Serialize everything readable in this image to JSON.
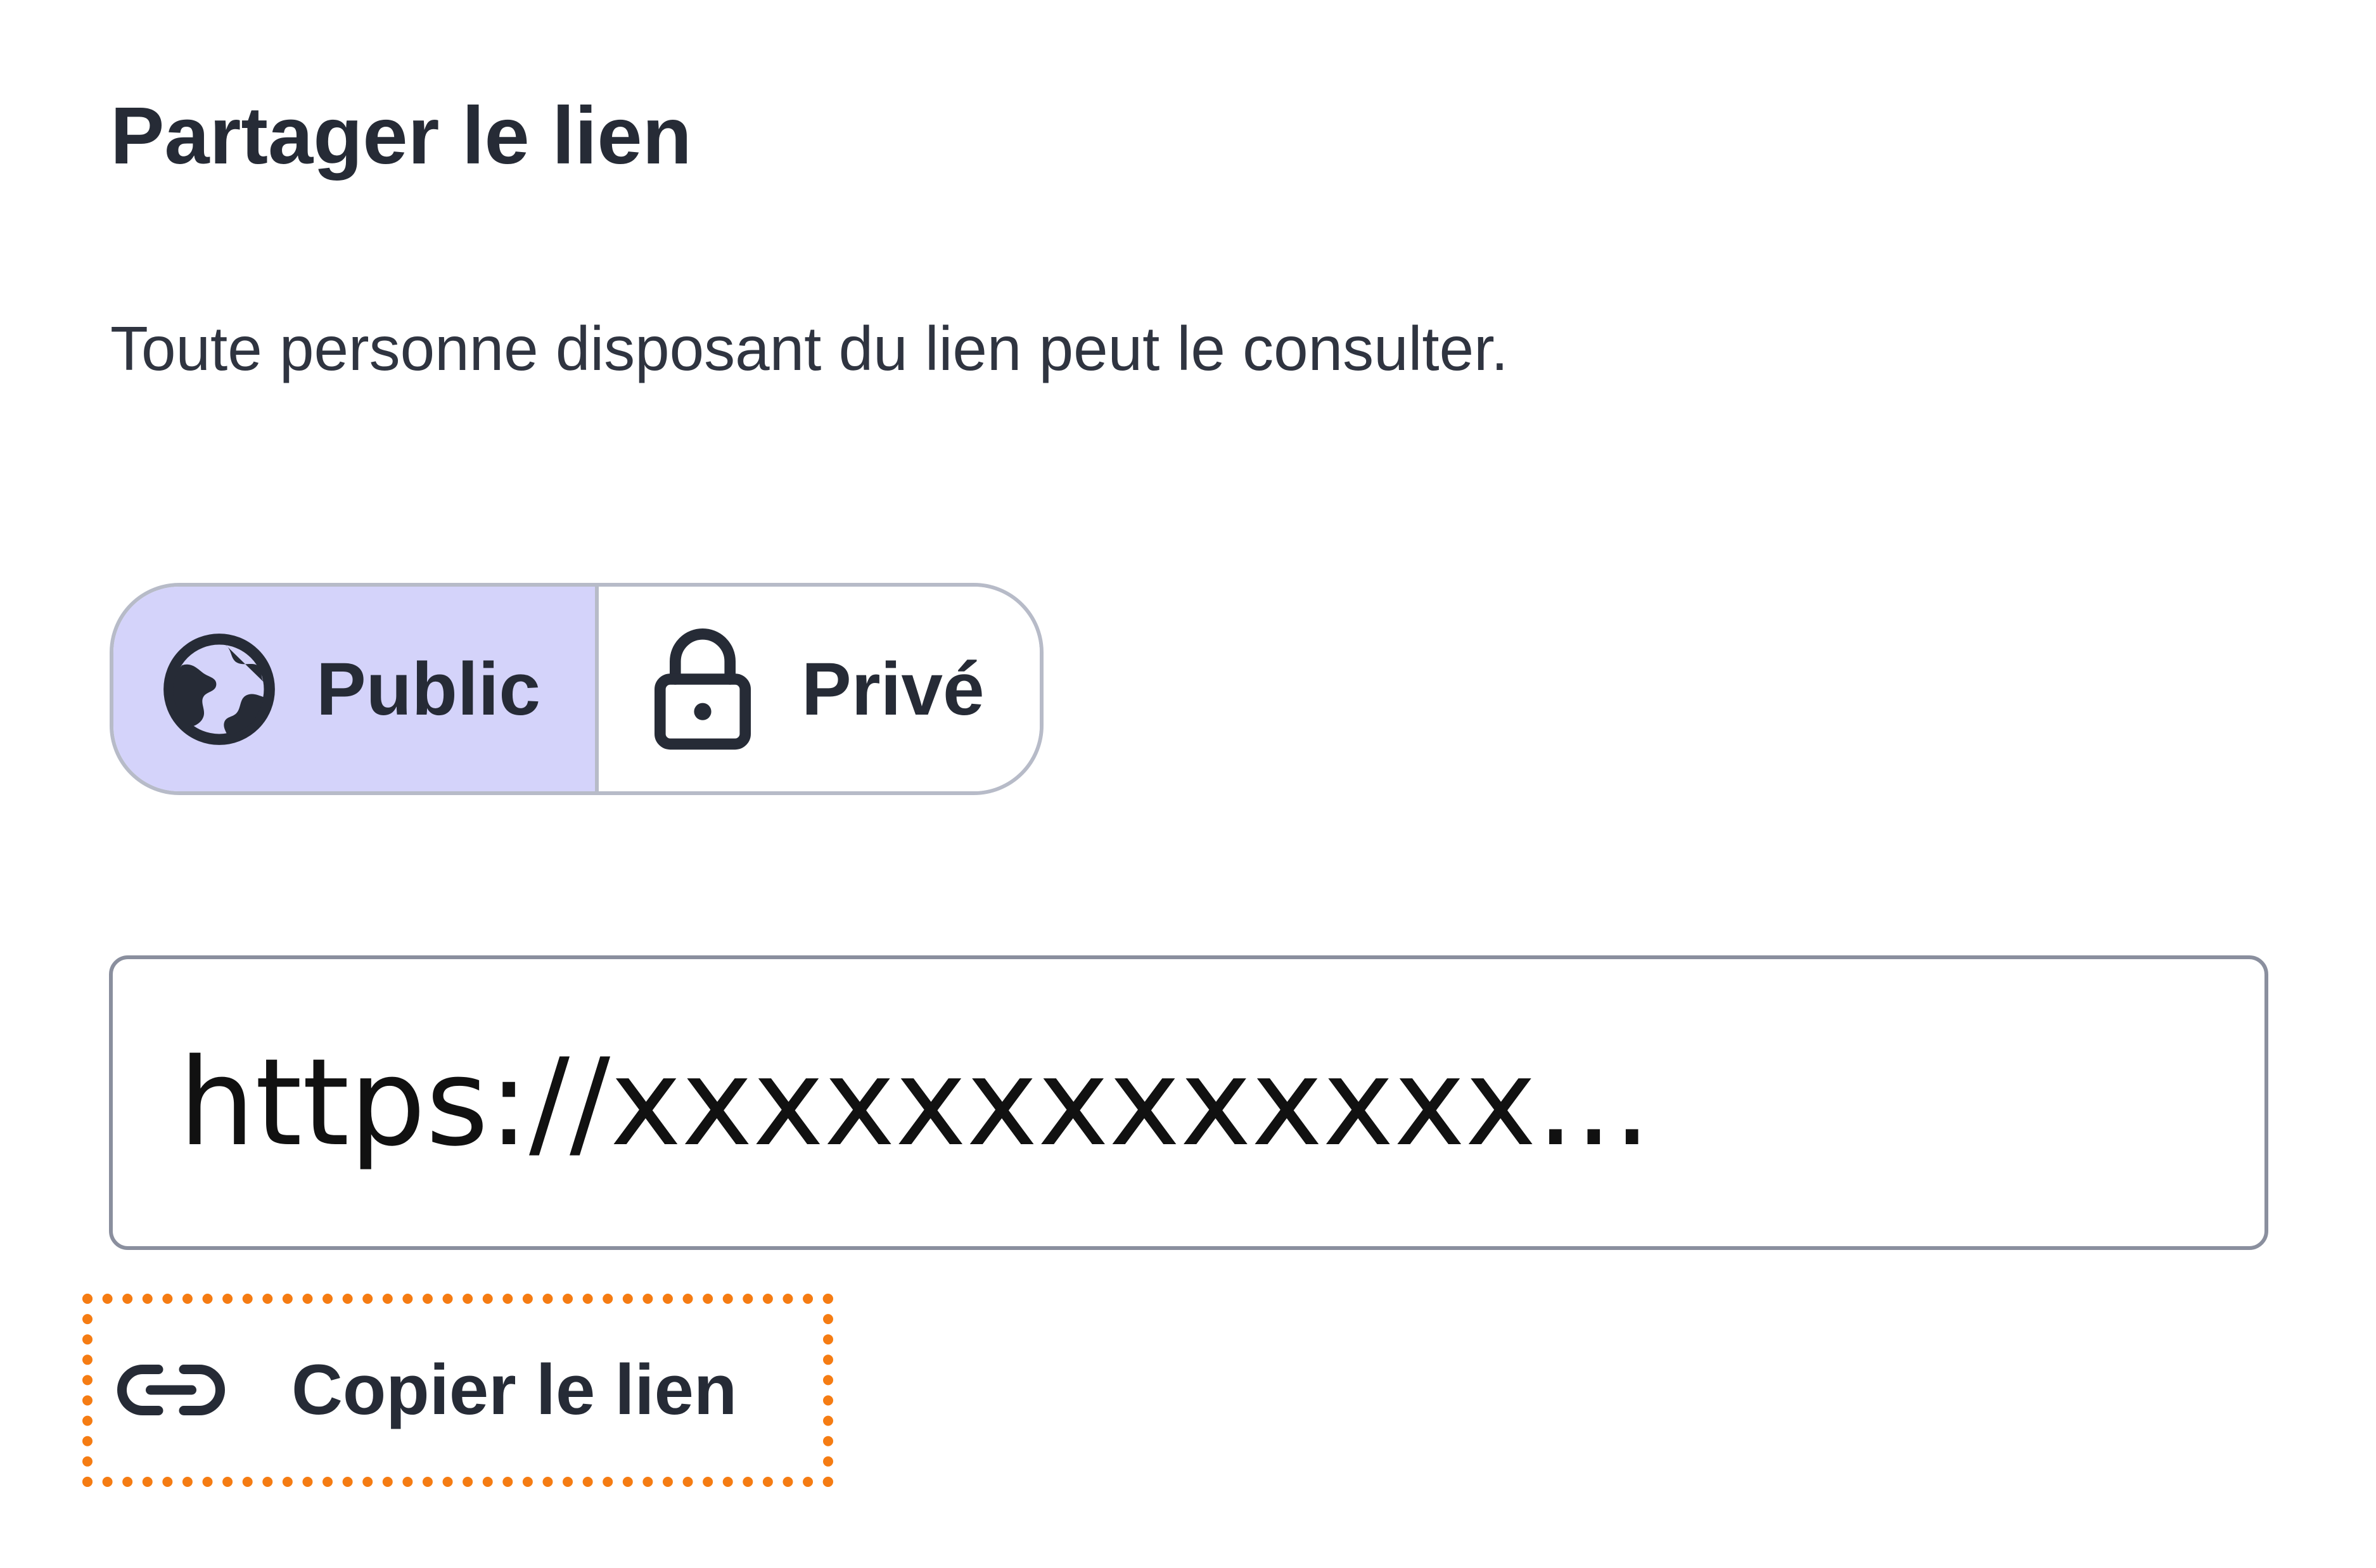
{
  "panel": {
    "title": "Partager le lien",
    "description": "Toute personne disposant du lien peut le consulter."
  },
  "visibility": {
    "selected": "public",
    "options": [
      {
        "id": "public",
        "label": "Public",
        "icon": "globe-icon"
      },
      {
        "id": "private",
        "label": "Privé",
        "icon": "lock-icon"
      }
    ],
    "selected_bg": "#d4d3fa"
  },
  "link_field": {
    "value": "https://xxxxxxxxxxxxx..."
  },
  "copy_button": {
    "label": "Copier le lien",
    "icon": "link-icon",
    "highlight_color": "#f57c13"
  }
}
